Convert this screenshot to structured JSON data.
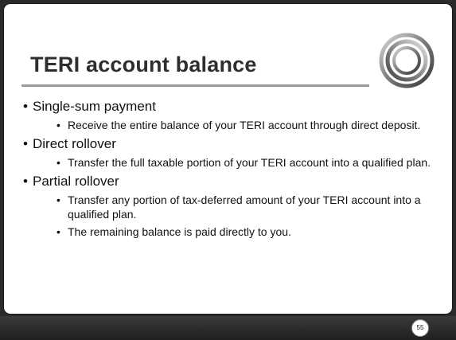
{
  "slide": {
    "title": "TERI account balance",
    "page_number": "55",
    "logo_icon": "concentric-rings-logo",
    "colors": {
      "frame": "#2b2b2b",
      "title": "#2e2e2e",
      "rule": "#9a9a9a"
    },
    "bullets": [
      {
        "text": "Single-sum payment",
        "sub": [
          "Receive the entire balance of your TERI account through direct deposit."
        ]
      },
      {
        "text": "Direct rollover",
        "sub": [
          "Transfer the full taxable portion of your TERI account into a qualified plan."
        ]
      },
      {
        "text": "Partial rollover",
        "sub": [
          "Transfer any portion of tax-deferred amount of your TERI account into a qualified plan.",
          "The remaining balance is paid directly to you."
        ]
      }
    ]
  }
}
